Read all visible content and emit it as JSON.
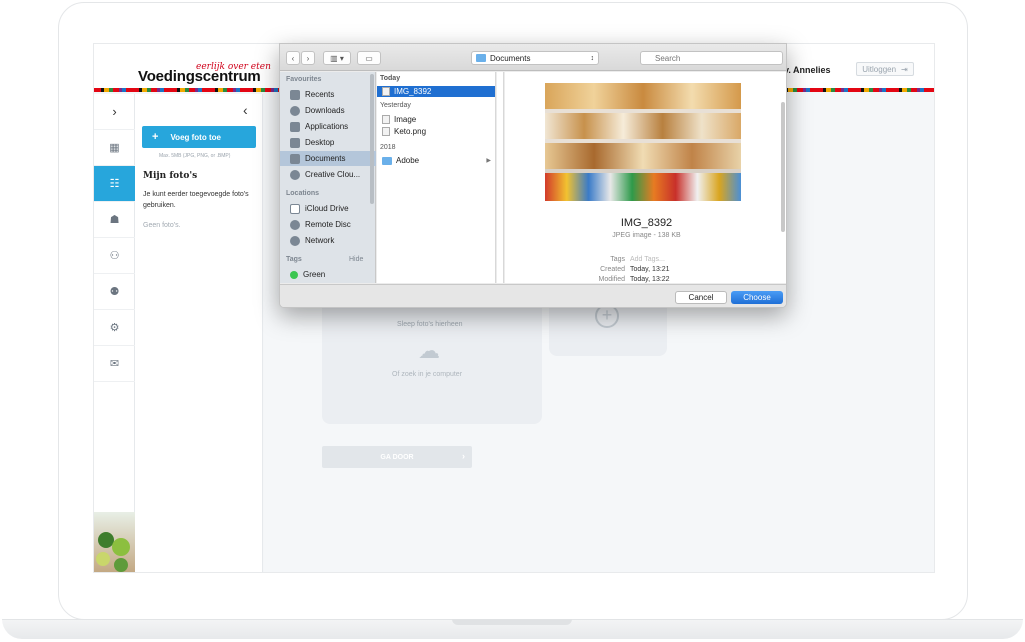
{
  "site": {
    "tagline": "eerlijk over eten",
    "name": "Voedingscentrum",
    "user": "v. Annelies",
    "logout_label": "Uitloggen"
  },
  "rail": {
    "toggle_icon": "chevron-right-icon",
    "items": [
      "dashboard-icon",
      "scan-icon",
      "bank-icon",
      "person-icon",
      "group-icon",
      "gear-icon",
      "mail-icon"
    ]
  },
  "panel": {
    "add_photo_label": "Voeg foto toe",
    "add_photo_hint": "Max. 5MB (JPG, PNG, or .BMP)",
    "my_photos_title": "Mijn foto's",
    "my_photos_desc": "Je kunt eerder toegevoegde foto's gebruiken.",
    "no_photos": "Geen foto's."
  },
  "main": {
    "drop_text": "Sleep foto's hierheen",
    "drop_sub": "Of zoek in je computer",
    "go_label": "GA DOOR"
  },
  "dialog": {
    "location": "Documents",
    "search_placeholder": "Search",
    "sidebar": {
      "favourites_title": "Favourites",
      "favourites": [
        "Recents",
        "Downloads",
        "Applications",
        "Desktop",
        "Documents",
        "Creative Clou..."
      ],
      "locations_title": "Locations",
      "locations": [
        "iCloud Drive",
        "Remote Disc",
        "Network"
      ],
      "tags_title": "Tags",
      "tags_hide": "Hide",
      "tags": [
        "Green"
      ]
    },
    "column": {
      "today": "Today",
      "today_items": [
        "IMG_8392"
      ],
      "yesterday": "Yesterday",
      "yesterday_items": [
        "Image",
        "Keto.png"
      ],
      "year": "2018",
      "year_items": [
        "Adobe"
      ]
    },
    "preview": {
      "name": "IMG_8392",
      "kind": "JPEG image - 138 KB",
      "tags_label": "Tags",
      "tags_value": "Add Tags...",
      "created_label": "Created",
      "created_value": "Today, 13:21",
      "modified_label": "Modified",
      "modified_value": "Today, 13:22"
    },
    "cancel_label": "Cancel",
    "choose_label": "Choose"
  },
  "colors": {
    "accent": "#27a6dc",
    "brand_red": "#d0021b",
    "mac_blue": "#1f6fd1",
    "tag_green": "#3cc651"
  }
}
